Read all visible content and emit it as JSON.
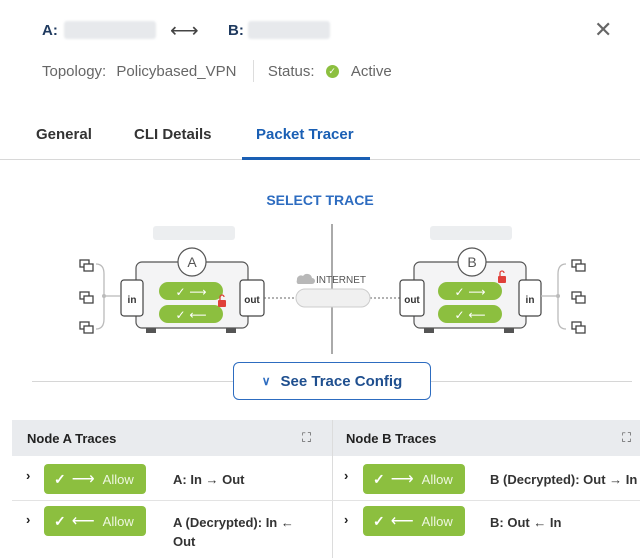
{
  "header": {
    "a_label": "A:",
    "b_label": "B:",
    "arrows": "⟷",
    "close": "✕"
  },
  "meta": {
    "topology_label": "Topology:",
    "topology_value": "Policybased_VPN",
    "status_label": "Status:",
    "status_value": "Active"
  },
  "tabs": [
    {
      "label": "General"
    },
    {
      "label": "CLI Details"
    },
    {
      "label": "Packet Tracer",
      "active": true
    }
  ],
  "diagram": {
    "title": "SELECT TRACE",
    "node_a": "A",
    "node_b": "B",
    "internet": "INTERNET",
    "in_label": "in",
    "out_label": "out"
  },
  "see_trace_config": "See Trace Config",
  "traces": {
    "node_a_title": "Node A Traces",
    "node_b_title": "Node B Traces",
    "allow_label": "Allow",
    "a_rows": [
      {
        "label": "A: In → Out",
        "arrow": "⟶"
      },
      {
        "label": "A (Decrypted): In ← Out",
        "arrow": "⟵"
      }
    ],
    "b_rows": [
      {
        "label": "B (Decrypted): Out → In",
        "arrow": "⟶"
      },
      {
        "label": "B: Out ← In",
        "arrow": "⟵"
      }
    ]
  },
  "colors": {
    "accent": "#2d6cc0",
    "allow_green": "#8cbf3f",
    "firewall_lock": "#e0403a"
  }
}
